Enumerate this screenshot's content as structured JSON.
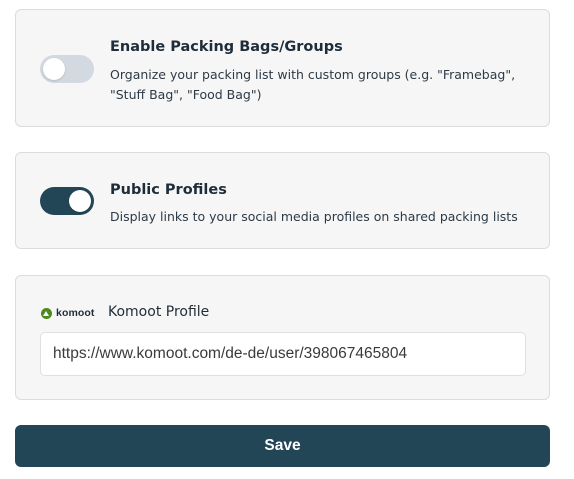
{
  "settings": {
    "packing_groups": {
      "title": "Enable Packing Bags/Groups",
      "description": "Organize your packing list with custom groups (e.g. \"Framebag\", \"Stuff Bag\", \"Food Bag\")",
      "enabled": false
    },
    "public_profiles": {
      "title": "Public Profiles",
      "description": "Display links to your social media profiles on shared packing lists",
      "enabled": true
    }
  },
  "komoot": {
    "logo_text": "komoot",
    "label": "Komoot Profile",
    "url_value": "https://www.komoot.com/de-de/user/398067465804"
  },
  "actions": {
    "save_label": "Save"
  },
  "colors": {
    "toggle_on": "#234657",
    "toggle_off": "#d3d9e0",
    "button": "#234657",
    "komoot_green": "#4c8a1f",
    "card_bg": "#f6f6f6"
  },
  "icons": {
    "komoot_logo": "komoot-logo-icon"
  }
}
